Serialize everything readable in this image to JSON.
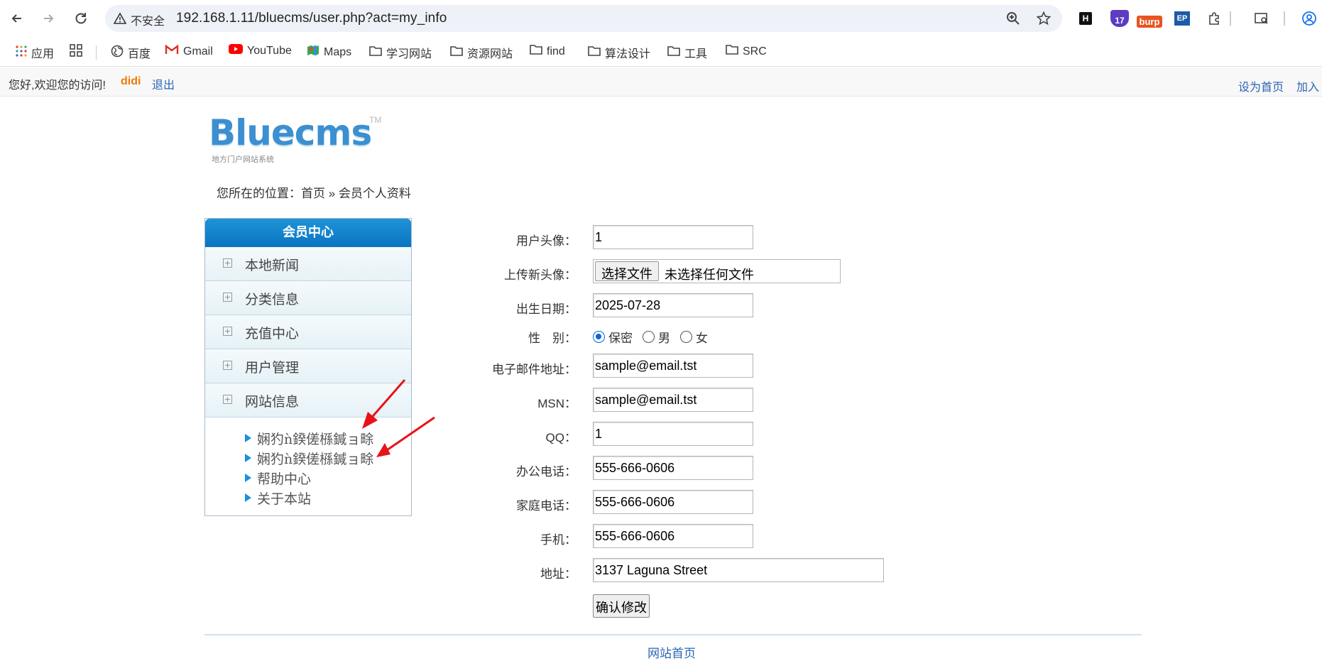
{
  "browser": {
    "security_label": "不安全",
    "url": "192.168.1.11/bluecms/user.php?act=my_info",
    "extensions": [
      "H",
      "17",
      "burp",
      "EP"
    ]
  },
  "bookmarks": [
    {
      "label": "应用",
      "icon": "apps-grid-icon"
    },
    {
      "label": "",
      "icon": "grid-icon"
    },
    {
      "label": "百度",
      "icon": "globe-icon"
    },
    {
      "label": "Gmail",
      "icon": "gmail-icon"
    },
    {
      "label": "YouTube",
      "icon": "youtube-icon"
    },
    {
      "label": "Maps",
      "icon": "maps-icon"
    },
    {
      "label": "学习网站",
      "icon": "folder-icon"
    },
    {
      "label": "资源网站",
      "icon": "folder-icon"
    },
    {
      "label": "find",
      "icon": "folder-icon"
    },
    {
      "label": "算法设计",
      "icon": "folder-icon"
    },
    {
      "label": "工具",
      "icon": "folder-icon"
    },
    {
      "label": "SRC",
      "icon": "folder-icon"
    }
  ],
  "topbar": {
    "welcome": "您好,欢迎您的访问!",
    "username": "didi",
    "logout": "退出",
    "set_home": "设为首页",
    "add_fav": "加入"
  },
  "logo": {
    "text": "Bluecms",
    "tm": "TM",
    "subtitle": "地方门户网站系统"
  },
  "breadcrumb": {
    "prefix": "您所在的位置：",
    "home": "首页",
    "sep": " » ",
    "current": "会员个人资料"
  },
  "sidebar": {
    "title": "会员中心",
    "items": [
      "本地新闻",
      "分类信息",
      "充值中心",
      "用户管理",
      "网站信息"
    ],
    "sub_items": [
      "娴犳ǹ鍨傞槂鍼ョ畭",
      "娴犳ǹ鍨傞槂鍼ョ畭",
      "帮助中心",
      "关于本站"
    ]
  },
  "form": {
    "avatar_label": "用户头像：",
    "avatar_value": "1",
    "upload_label": "上传新头像：",
    "file_button": "选择文件",
    "file_status": "未选择任何文件",
    "birthday_label": "出生日期：",
    "birthday_value": "2025-07-28",
    "gender_label": "性　别：",
    "gender_options": [
      "保密",
      "男",
      "女"
    ],
    "gender_selected": "保密",
    "email_label": "电子邮件地址：",
    "email_value": "sample@email.tst",
    "msn_label": "MSN：",
    "msn_value": "sample@email.tst",
    "qq_label": "QQ：",
    "qq_value": "1",
    "office_phone_label": "办公电话：",
    "office_phone_value": "555-666-0606",
    "home_phone_label": "家庭电话：",
    "home_phone_value": "555-666-0606",
    "mobile_label": "手机：",
    "mobile_value": "555-666-0606",
    "address_label": "地址：",
    "address_value": "3137 Laguna Street",
    "submit_label": "确认修改"
  },
  "footer": {
    "home_link": "网站首页"
  },
  "colors": {
    "accent": "#0a74c0",
    "link": "#2a64b4",
    "username": "#f07800",
    "annotation_arrow": "#e8121b"
  }
}
